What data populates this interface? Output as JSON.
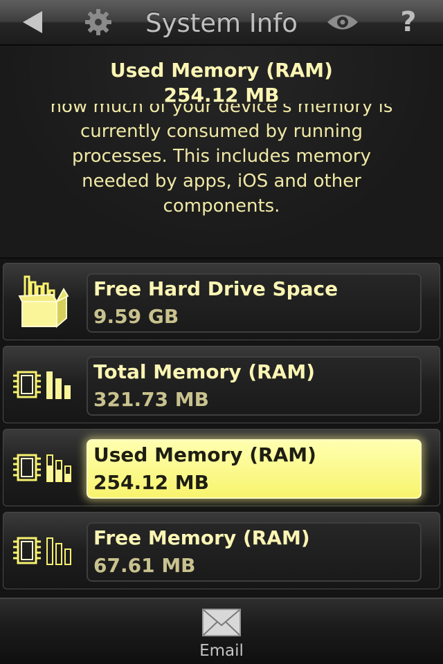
{
  "header": {
    "title": "System Info",
    "back_icon": "back-arrow-icon",
    "settings_icon": "gear-icon",
    "view_icon": "eye-icon",
    "help_label": "?"
  },
  "info": {
    "heading": "Used Memory (RAM)",
    "value": "254.12 MB",
    "description_lines": [
      "how much of your device's memory is",
      "currently consumed by running",
      "processes.  This includes memory",
      "needed by apps, iOS and other",
      "components."
    ]
  },
  "rows": [
    {
      "label": "Free Hard Drive Space",
      "value": "9.59 GB",
      "icon": "storage-box-icon",
      "selected": false
    },
    {
      "label": "Total Memory (RAM)",
      "value": "321.73 MB",
      "icon": "ram-chip-full-bars-icon",
      "selected": false
    },
    {
      "label": "Used Memory (RAM)",
      "value": "254.12 MB",
      "icon": "ram-chip-partial-bars-icon",
      "selected": true
    },
    {
      "label": "Free Memory (RAM)",
      "value": "67.61 MB",
      "icon": "ram-chip-outline-bars-icon",
      "selected": false
    }
  ],
  "footer": {
    "email_label": "Email",
    "email_icon": "envelope-icon"
  },
  "colors": {
    "accent_yellow": "#f8f46e",
    "text_yellow": "#fbf5b4",
    "header_gray": "#3e3e3e"
  }
}
